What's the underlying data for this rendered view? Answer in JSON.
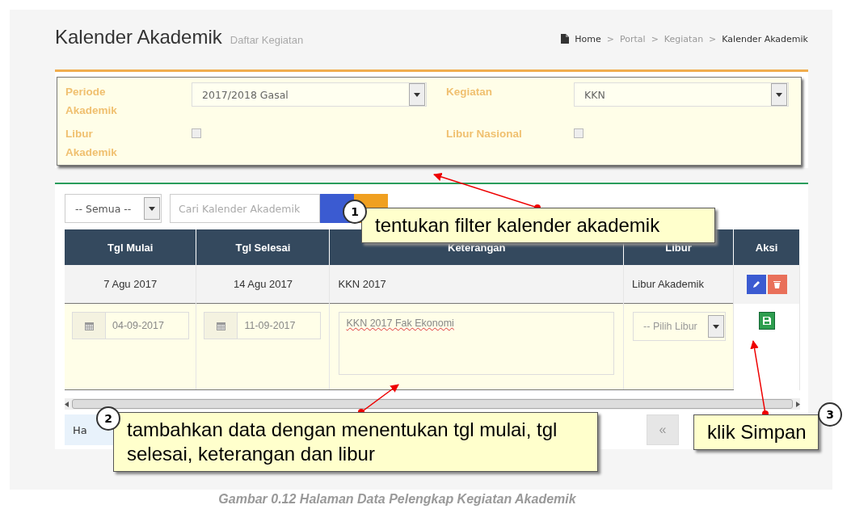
{
  "header": {
    "title": "Kalender Akademik",
    "subtitle": "Daftar Kegiatan",
    "separator": ">",
    "breadcrumb": [
      "Home",
      "Portal",
      "Kegiatan",
      "Kalender Akademik"
    ]
  },
  "filter": {
    "fields": [
      {
        "kind": "select",
        "label": "Periode Akademik",
        "value": "2017/2018 Gasal"
      },
      {
        "kind": "select",
        "label": "Kegiatan",
        "value": "KKN"
      },
      {
        "kind": "checkbox",
        "label": "Libur Akademik",
        "checked": false
      },
      {
        "kind": "checkbox",
        "label": "Libur Nasional",
        "checked": false
      }
    ]
  },
  "toolbar": {
    "status_select": "-- Semua --",
    "search": {
      "placeholder": "Cari Kalender Akademik"
    }
  },
  "table": {
    "columns": [
      "Tgl Mulai",
      "Tgl Selesai",
      "Keterangan",
      "Libur",
      "Aksi"
    ],
    "rows": [
      {
        "tgl_mulai": "7 Agu 2017",
        "tgl_selesai": "14 Agu 2017",
        "keterangan": "KKN 2017",
        "libur": "Libur Akademik"
      }
    ],
    "new_row": {
      "tgl_mulai": "04-09-2017",
      "tgl_selesai": "11-09-2017",
      "keterangan": "KKN 2017 Fak Ekonomi",
      "libur_placeholder": "-- Pilih Libur"
    }
  },
  "footer": {
    "info": "Ha",
    "pager": [
      "«"
    ]
  },
  "callouts": [
    {
      "number": "1",
      "text": "tentukan filter kalender akademik"
    },
    {
      "number": "2",
      "text": "tambahkan data dengan menentukan tgl mulai, tgl selesai, keterangan dan libur"
    },
    {
      "number": "3",
      "text": "klik Simpan"
    }
  ],
  "caption": "Gambar 0.12 Halaman Data Pelengkap Kegiatan Akademik"
}
